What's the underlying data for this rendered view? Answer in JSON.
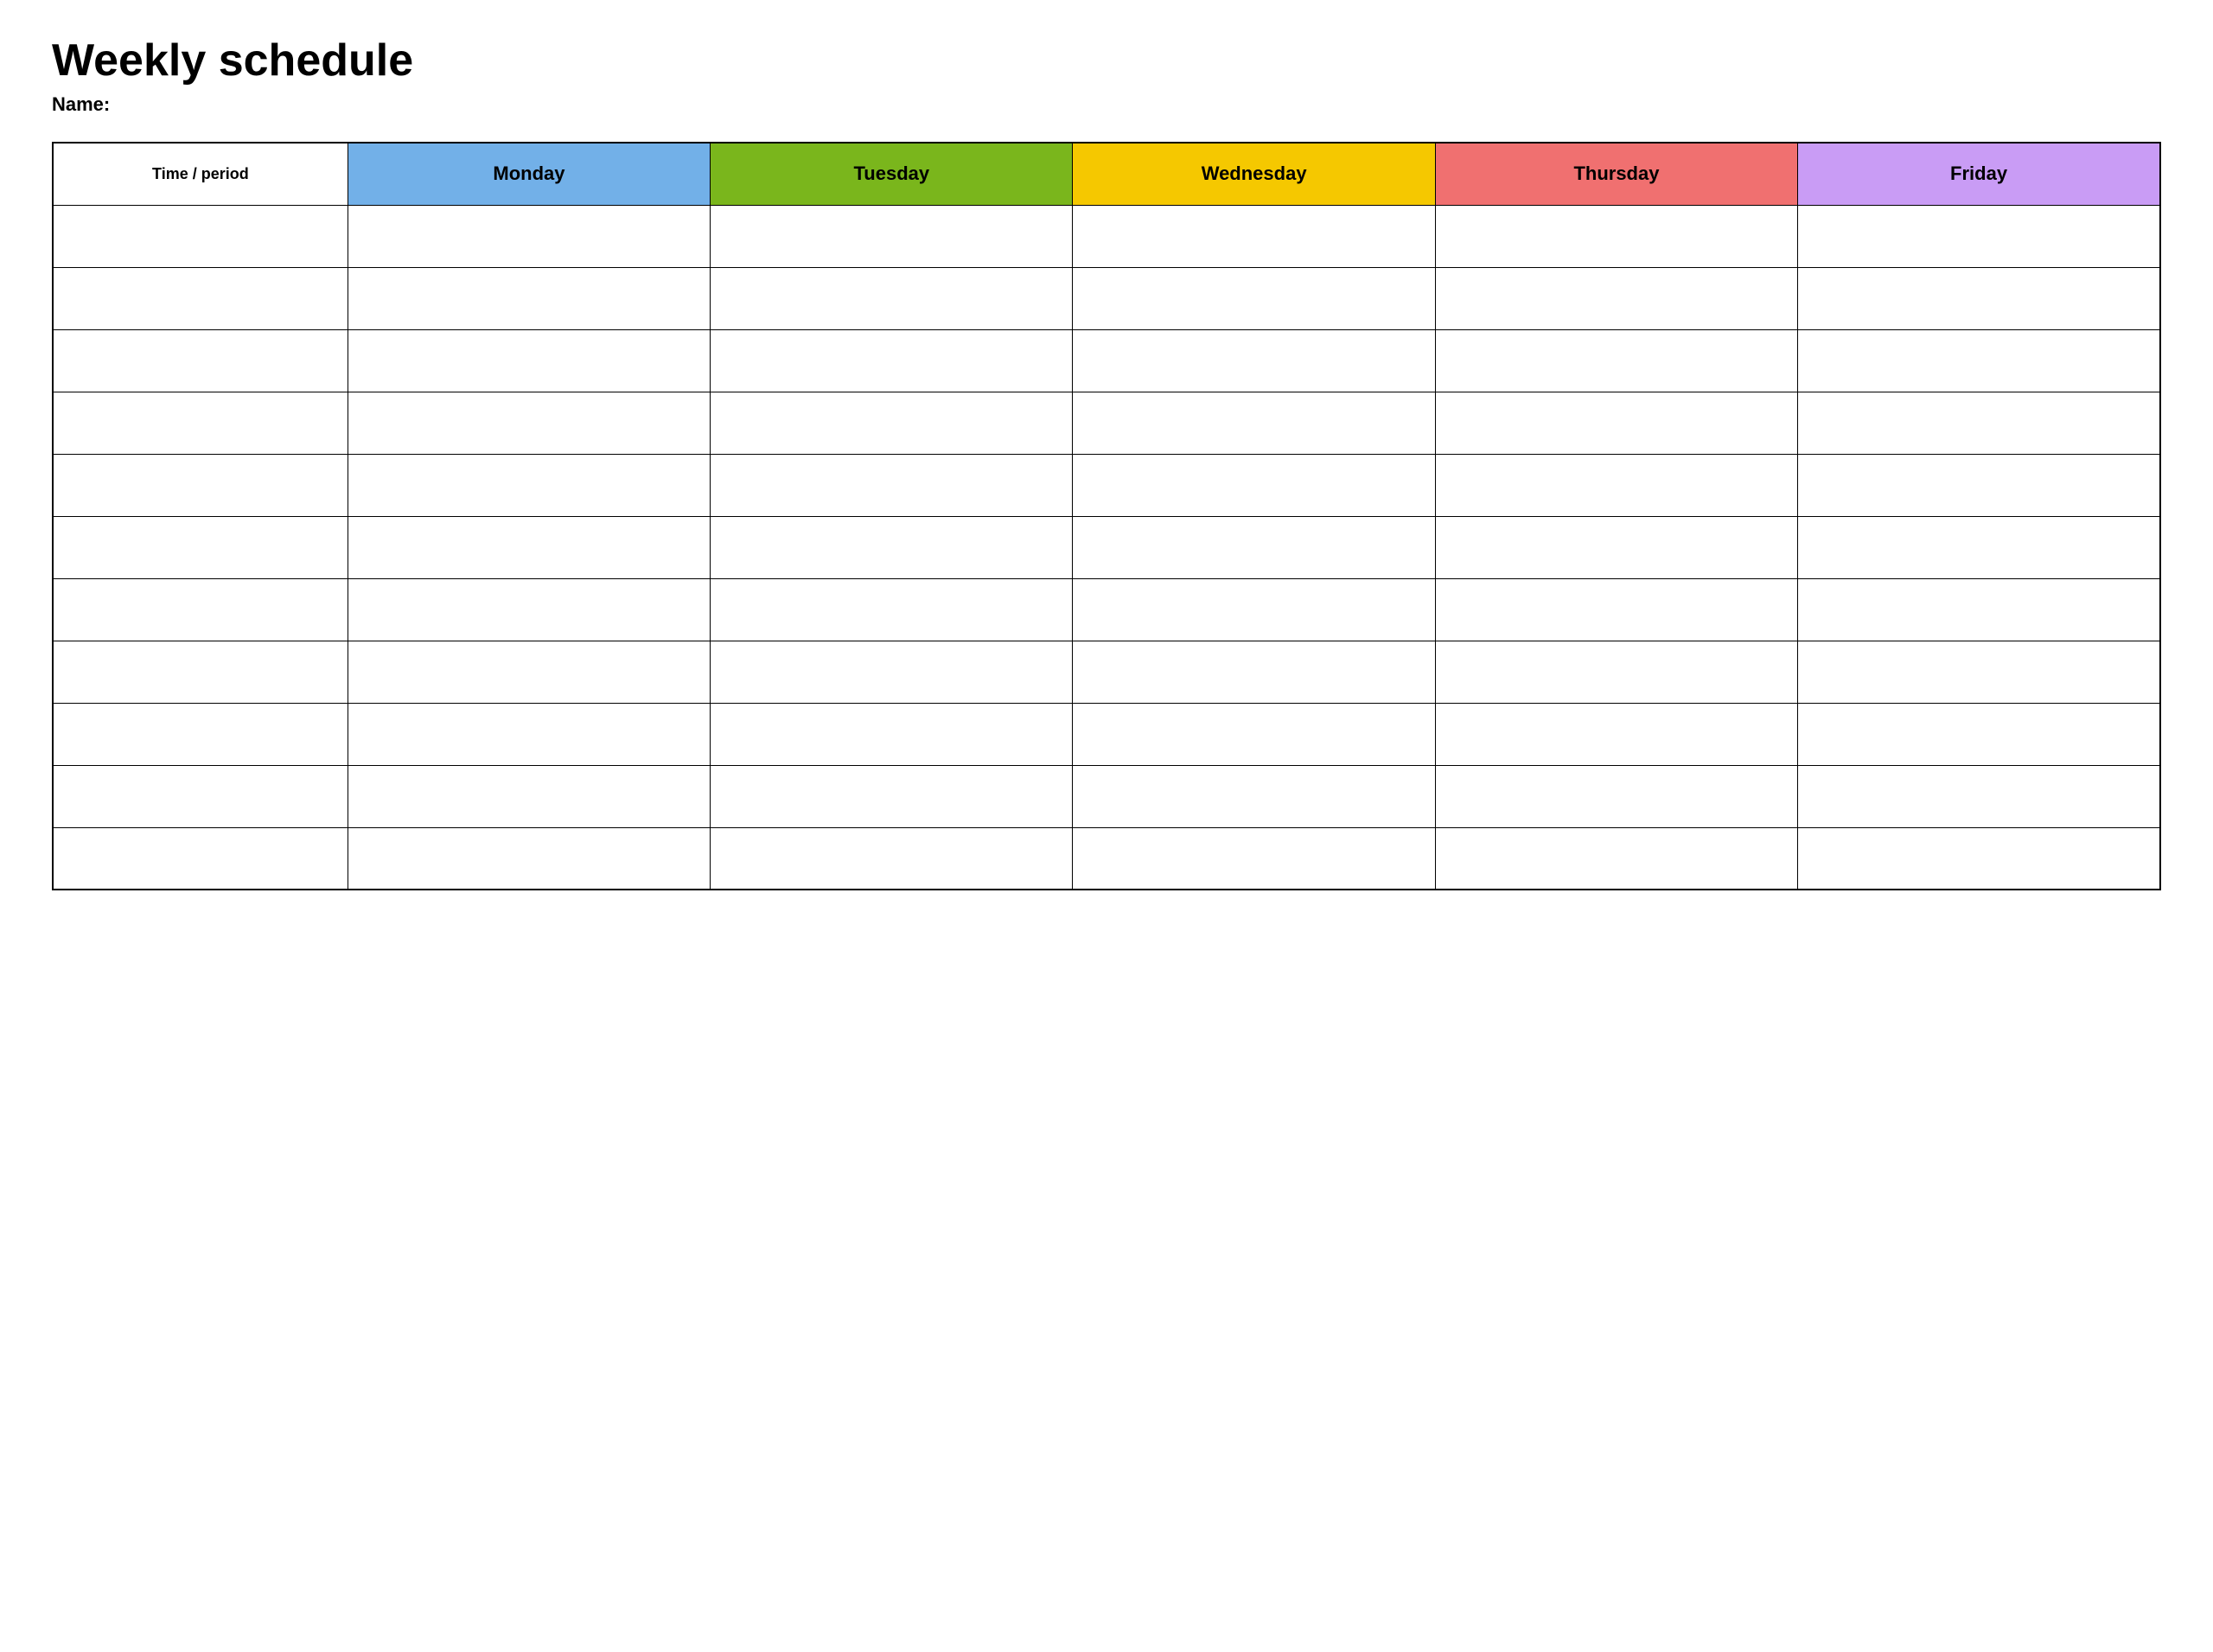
{
  "page": {
    "title": "Weekly schedule",
    "name_label": "Name:"
  },
  "table": {
    "header": {
      "time_period": "Time / period",
      "monday": "Monday",
      "tuesday": "Tuesday",
      "wednesday": "Wednesday",
      "thursday": "Thursday",
      "friday": "Friday"
    },
    "rows": 11
  }
}
